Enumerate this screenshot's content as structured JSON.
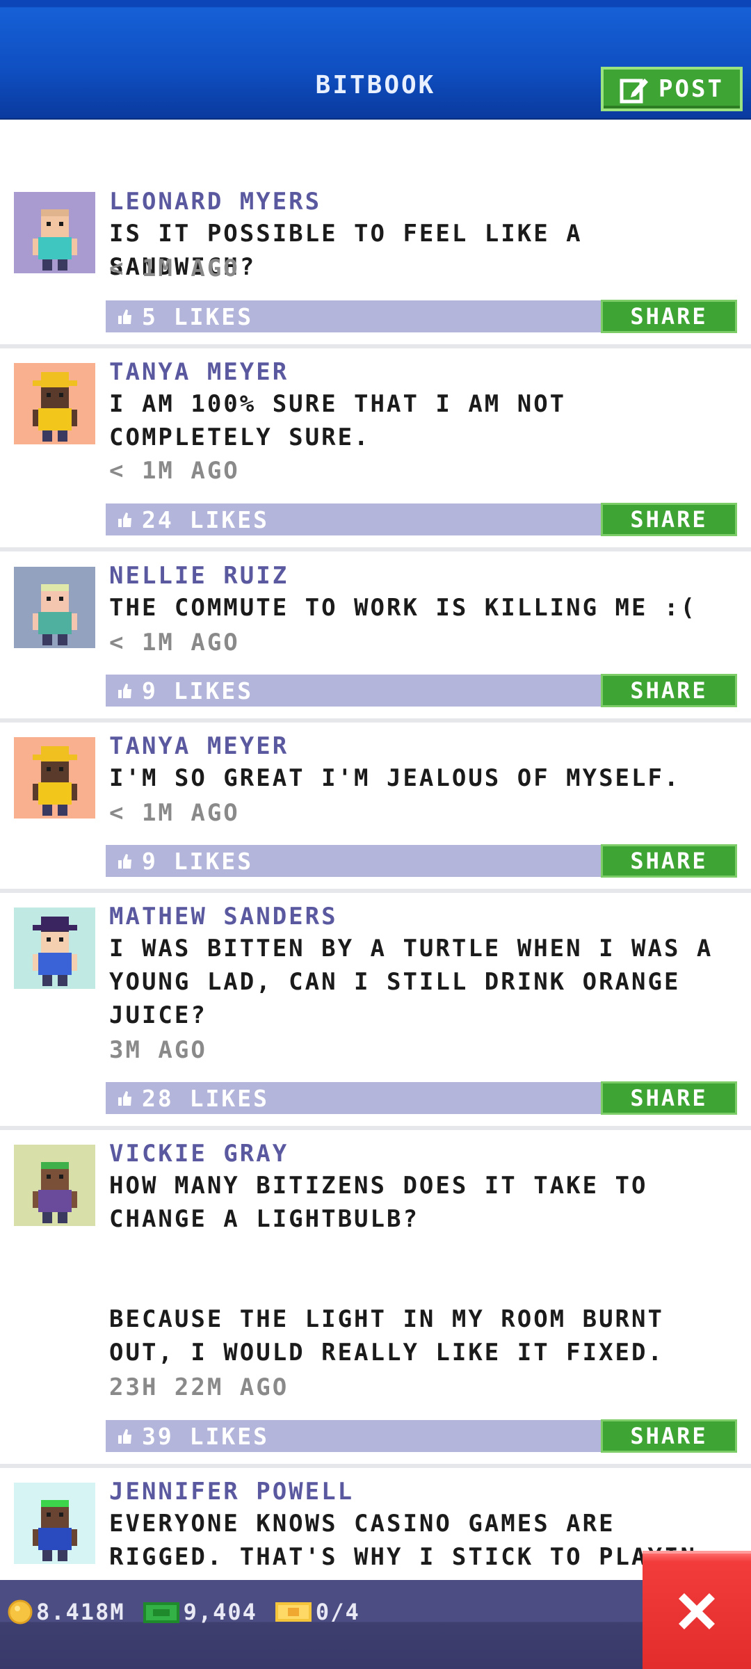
{
  "header": {
    "title": "BITBOOK",
    "post_label": "POST"
  },
  "posts": [
    {
      "name": "LEONARD MYERS",
      "message": "IS IT POSSIBLE TO FEEL LIKE A SANDWICH?",
      "time": "< 1M AGO",
      "likes": "5 LIKES",
      "share": "SHARE",
      "avatar_bg": "#a99bd0",
      "skin": "#f2c6a2",
      "hair": "#e0b48c",
      "shirt": "#3fc6c0",
      "hat": ""
    },
    {
      "name": "TANYA MEYER",
      "message": "I AM 100% SURE THAT I AM NOT COMPLETELY SURE.",
      "time": "< 1M AGO",
      "likes": "24 LIKES",
      "share": "SHARE",
      "avatar_bg": "#f8b08e",
      "skin": "#5a3a2a",
      "hair": "#f0c020",
      "shirt": "#f2c61a",
      "hat": "#f0c020"
    },
    {
      "name": "NELLIE RUIZ",
      "message": "THE COMMUTE TO WORK IS KILLING ME :(",
      "time": "< 1M AGO",
      "likes": "9 LIKES",
      "share": "SHARE",
      "avatar_bg": "#93a3bf",
      "skin": "#f4c6b0",
      "hair": "#dfe8a8",
      "shirt": "#4fb0a0",
      "hat": ""
    },
    {
      "name": "TANYA MEYER",
      "message": "I'M SO GREAT I'M JEALOUS OF MYSELF.",
      "time": "< 1M AGO",
      "likes": "9 LIKES",
      "share": "SHARE",
      "avatar_bg": "#f8b08e",
      "skin": "#5a3a2a",
      "hair": "#f0c020",
      "shirt": "#f2c61a",
      "hat": "#f0c020"
    },
    {
      "name": "MATHEW SANDERS",
      "message": "I WAS BITTEN BY A TURTLE WHEN I WAS A YOUNG LAD, CAN I STILL DRINK ORANGE JUICE?",
      "time": "3M AGO",
      "likes": "28 LIKES",
      "share": "SHARE",
      "avatar_bg": "#bfe9e2",
      "skin": "#f4cfb0",
      "hair": "#3b2a4a",
      "shirt": "#3a63d8",
      "hat": "#3b2560"
    },
    {
      "name": "VICKIE GRAY",
      "message": "HOW MANY BITIZENS DOES IT TAKE TO CHANGE A LIGHTBULB?\n\n\nBECAUSE THE LIGHT IN MY ROOM BURNT OUT, I WOULD REALLY LIKE IT FIXED.",
      "time": "23H 22M AGO",
      "likes": "39 LIKES",
      "share": "SHARE",
      "avatar_bg": "#d9dfa8",
      "skin": "#7a5038",
      "hair": "#3fb04a",
      "shirt": "#6a4a9a",
      "hat": ""
    },
    {
      "name": "JENNIFER POWELL",
      "message": "EVERYONE KNOWS CASINO GAMES ARE RIGGED. THAT'S WHY I STICK TO PLAYIN",
      "time": "",
      "likes": "",
      "share": "",
      "avatar_bg": "#d6f4f4",
      "skin": "#6a4432",
      "hair": "#3bd44a",
      "shirt": "#2a4ac0",
      "hat": ""
    }
  ],
  "footer": {
    "coins": "8.418M",
    "bux": "9,404",
    "tickets": "0/4"
  },
  "colors": {
    "header_blue": "#0f4fc2",
    "accent_green": "#3ea535",
    "likes_bar": "#b4b5db",
    "name_purple": "#5a59a0",
    "close_red": "#e22c2c"
  }
}
